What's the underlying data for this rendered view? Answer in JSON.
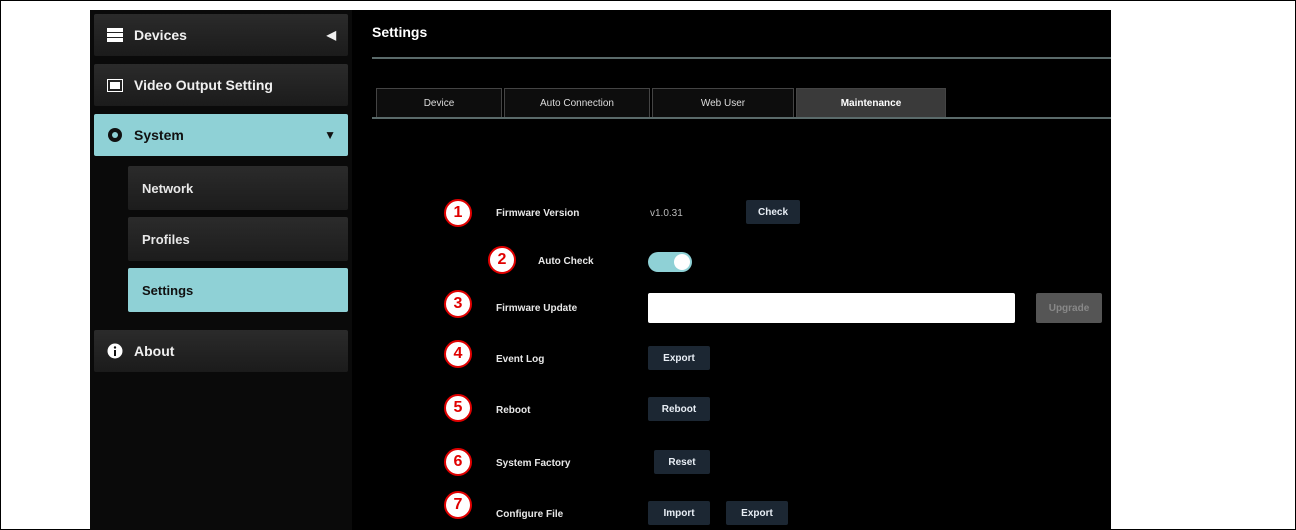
{
  "sidebar": {
    "devices": {
      "label": "Devices",
      "icon": "devices-icon",
      "arrow": "◀"
    },
    "video_output": {
      "label": "Video Output Setting",
      "icon": "monitor-icon"
    },
    "system": {
      "label": "System",
      "icon": "gear-icon",
      "arrow": "▼"
    },
    "sub_items": [
      {
        "label": "Network"
      },
      {
        "label": "Profiles"
      },
      {
        "label": "Settings"
      }
    ],
    "about": {
      "label": "About",
      "icon": "info-icon"
    }
  },
  "main": {
    "title": "Settings",
    "tabs": [
      {
        "label": "Device"
      },
      {
        "label": "Auto Connection"
      },
      {
        "label": "Web User"
      },
      {
        "label": "Maintenance"
      }
    ],
    "active_tab": "Maintenance",
    "rows": [
      {
        "num": "1",
        "label": "Firmware Version",
        "value": "v1.0.31",
        "button": "Check"
      },
      {
        "num": "2",
        "label": "Auto Check",
        "toggle_on": true
      },
      {
        "num": "3",
        "label": "Firmware Update",
        "input_value": "",
        "button": "Upgrade"
      },
      {
        "num": "4",
        "label": "Event Log",
        "button": "Export"
      },
      {
        "num": "5",
        "label": "Reboot",
        "button": "Reboot"
      },
      {
        "num": "6",
        "label": "System Factory",
        "button": "Reset"
      },
      {
        "num": "7",
        "label": "Configure File",
        "button": "Import",
        "button2": "Export"
      }
    ]
  },
  "colors": {
    "accent": "#8fd1d6",
    "badge": "#e00000",
    "button_bg": "#1c2733"
  }
}
